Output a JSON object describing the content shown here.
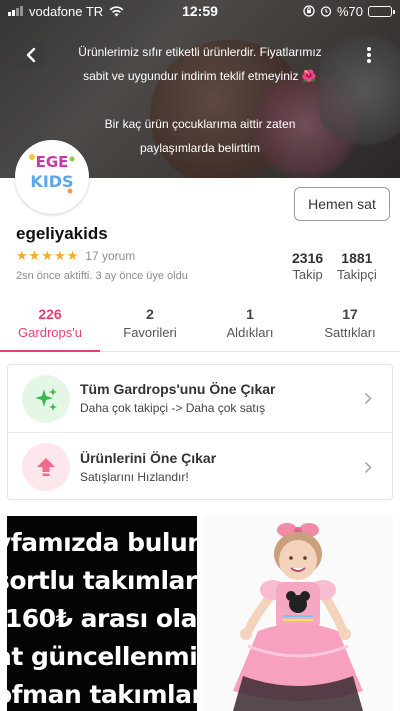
{
  "status_bar": {
    "carrier": "vodafone TR",
    "time": "12:59",
    "battery": "%70",
    "battery_level": 0.7
  },
  "header": {
    "announcement_line1": "Ürünlerimiz sıfır etiketli ürünlerdir.  Fiyatlarımız",
    "announcement_line2": "sabit ve uygundur indirim teklif etmeyiniz",
    "announcement_line3": "Bir kaç ürün çocuklarıma aittir zaten",
    "announcement_line4": "paylaşımlarda belirttim",
    "flower_emoji": "🌺",
    "back_icon": "chevron-left-icon",
    "more_icon": "more-vertical-icon"
  },
  "profile": {
    "logo_text_top": "EGE",
    "logo_text_bottom": "KIDS",
    "username": "egeliyakids",
    "star_icons": [
      "★",
      "★",
      "★",
      "★",
      "★"
    ],
    "review_count": "17 yorum",
    "rating": 5,
    "activity": "2sn önce aktifti. 3 ay önce üye oldu",
    "sell_button": "Hemen sat",
    "followers_count": "2316",
    "followers_label": "Takip",
    "following_count": "1881",
    "following_label": "Takipçi"
  },
  "tabs": [
    {
      "count": "226",
      "label": "Gardrops'u",
      "active": true
    },
    {
      "count": "2",
      "label": "Favorileri",
      "active": false
    },
    {
      "count": "1",
      "label": "Aldıkları",
      "active": false
    },
    {
      "count": "17",
      "label": "Sattıkları",
      "active": false
    }
  ],
  "promos": [
    {
      "title": "Tüm Gardrops'unu Öne Çıkar",
      "subtitle": "Daha çok takipçi -> Daha çok satış",
      "icon": "sparkle-icon"
    },
    {
      "title": "Ürünlerini Öne Çıkar",
      "subtitle": "Satışlarını Hızlandır!",
      "icon": "boost-arrow-icon"
    }
  ],
  "products": {
    "banner_lines": [
      "yfamızda bulun",
      "şortlu takımlar",
      "-160₺ arası ola",
      "at güncellenmis",
      "ofman takımlar"
    ]
  },
  "colors": {
    "accent": "#e83e75",
    "star": "#f7a928",
    "promo1_bg": "#e4f7e6",
    "promo1_icon": "#39b54a",
    "promo2_bg": "#fde6ec",
    "promo2_icon": "#f06b8a"
  }
}
